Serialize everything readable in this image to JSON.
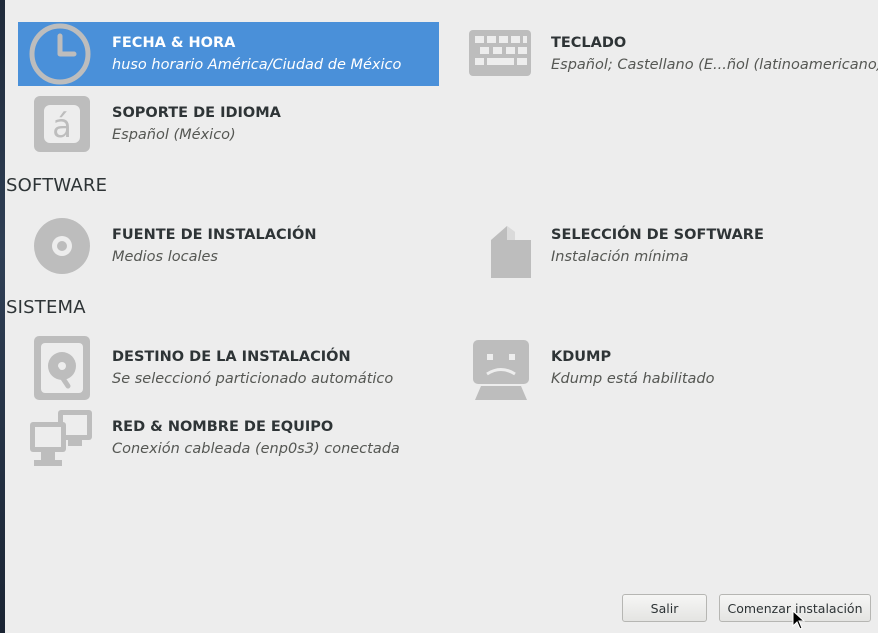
{
  "localization_spokes": [
    {
      "title": "FECHA & HORA",
      "status": "huso horario América/Ciudad de México",
      "icon": "clock-icon",
      "selected": true
    },
    {
      "title": "TECLADO",
      "status": "Español; Castellano (E...ñol (latinoamericano))",
      "icon": "keyboard-icon"
    },
    {
      "title": "SOPORTE DE IDIOMA",
      "status": "Español (México)",
      "icon": "language-icon",
      "icon_glyph": "á"
    }
  ],
  "sections": {
    "software": "SOFTWARE",
    "sistema": "SISTEMA"
  },
  "software_spokes": [
    {
      "title": "FUENTE DE INSTALACIÓN",
      "status": "Medios locales",
      "icon": "disc-icon"
    },
    {
      "title": "SELECCIÓN DE SOFTWARE",
      "status": "Instalación mínima",
      "icon": "package-icon"
    }
  ],
  "system_spokes": [
    {
      "title": "DESTINO DE LA INSTALACIÓN",
      "status": "Se seleccionó particionado automático",
      "icon": "harddisk-icon"
    },
    {
      "title": "KDUMP",
      "status": "Kdump está habilitado",
      "icon": "kdump-icon"
    },
    {
      "title": "RED & NOMBRE DE EQUIPO",
      "status": "Conexión cableada (enp0s3) conectada",
      "icon": "network-icon"
    }
  ],
  "buttons": {
    "quit": "Salir",
    "begin": "Comenzar instalación"
  },
  "colors": {
    "selected_bg": "#4a90d9",
    "background": "#ededed",
    "icon_gray": "#bdbdbd"
  }
}
